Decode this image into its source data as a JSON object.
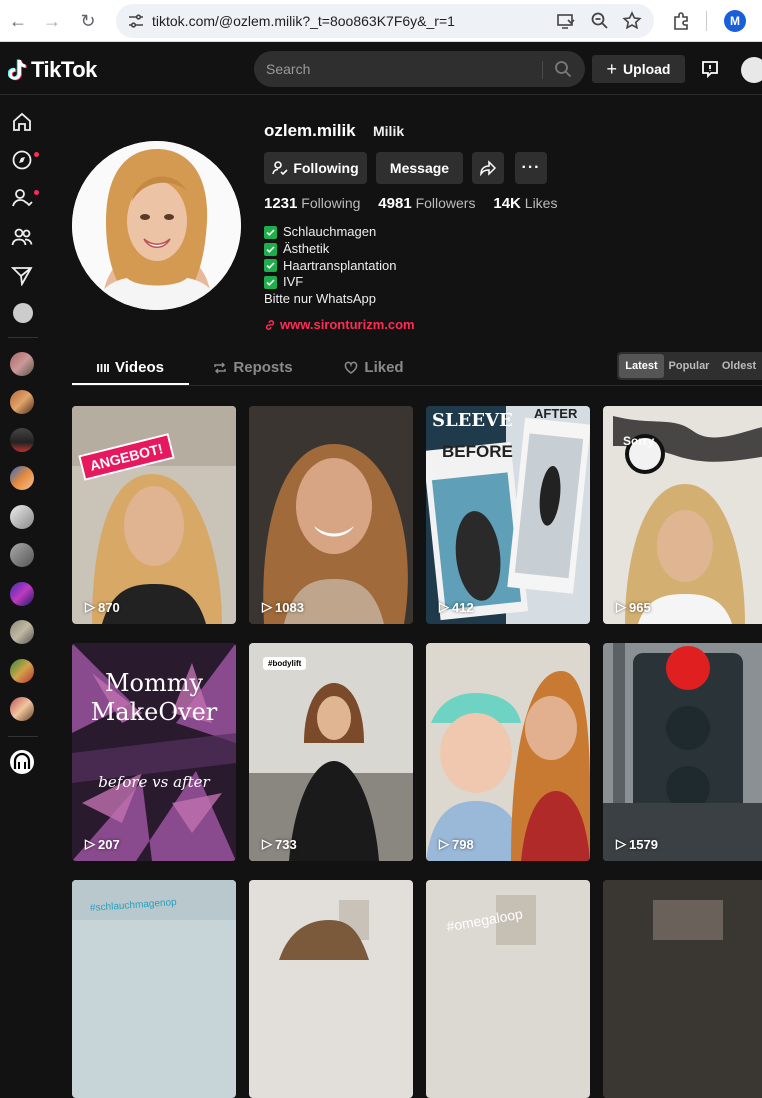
{
  "browser": {
    "url": "tiktok.com/@ozlem.milik?_t=8oo863K7F6y&_r=1",
    "profile_initial": "M"
  },
  "header": {
    "brand": "TikTok",
    "search_placeholder": "Search",
    "upload_label": "Upload"
  },
  "profile": {
    "username": "ozlem.milik",
    "nickname": "Milik",
    "following_btn": "Following",
    "message_btn": "Message",
    "stats": {
      "following_count": "1231",
      "following_label": "Following",
      "followers_count": "4981",
      "followers_label": "Followers",
      "likes_count": "14K",
      "likes_label": "Likes"
    },
    "bio_checks": [
      "Schlauchmagen",
      "Ästhetik",
      "Haartransplantation",
      "IVF"
    ],
    "bio_line": "Bitte nur WhatsApp",
    "link": "www.sironturizm.com"
  },
  "tabs": [
    "Videos",
    "Reposts",
    "Liked"
  ],
  "sort_options": [
    "Latest",
    "Popular",
    "Oldest"
  ],
  "videos": [
    {
      "views": "870",
      "overlay": "ANGEBOT!"
    },
    {
      "views": "1083",
      "overlay": ""
    },
    {
      "views": "412",
      "overlay": "BEFORE",
      "overlay2": "AFTER",
      "overlay3": "SLEEVE"
    },
    {
      "views": "965",
      "overlay": "Sorry"
    },
    {
      "views": "207",
      "overlay": "Mommy MakeOver",
      "overlay2": "before vs after"
    },
    {
      "views": "733",
      "overlay": "#bodylift"
    },
    {
      "views": "798",
      "overlay": ""
    },
    {
      "views": "1579",
      "overlay": ""
    },
    {
      "views": "",
      "overlay": "#schlauchmagenop"
    },
    {
      "views": "",
      "overlay": ""
    },
    {
      "views": "",
      "overlay": "#omegaloop"
    },
    {
      "views": "",
      "overlay": ""
    }
  ],
  "colors": {
    "accent": "#fe2c55",
    "check": "#1fae4b",
    "bg": "#121212"
  }
}
